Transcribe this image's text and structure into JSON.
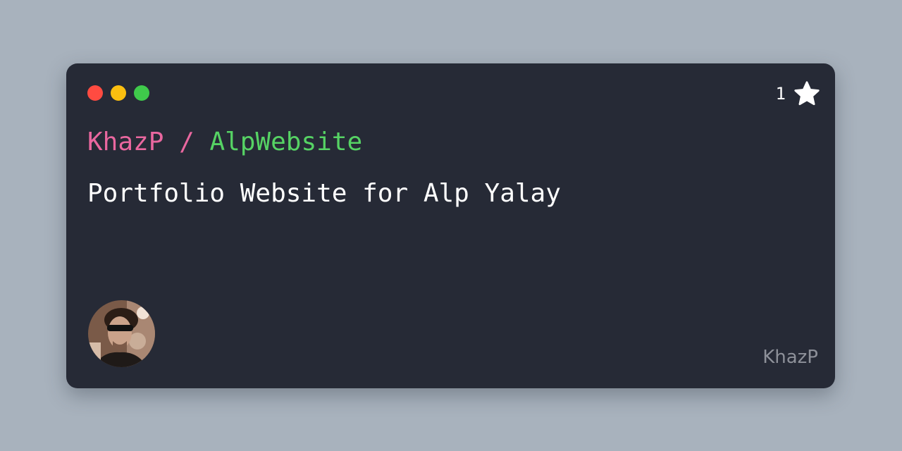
{
  "window_controls": {
    "close_color": "#ff4b41",
    "minimize_color": "#fbbf10",
    "maximize_color": "#3fca4b"
  },
  "stars": {
    "count": "1",
    "icon": "star-icon"
  },
  "repo": {
    "owner": "KhazP",
    "separator": "/",
    "name": "AlpWebsite"
  },
  "description": "Portfolio Website for Alp Yalay",
  "avatar": {
    "icon": "avatar-photo"
  },
  "footer": {
    "username": "KhazP"
  },
  "colors": {
    "background": "#a8b2bd",
    "card": "#262a36",
    "owner": "#e9679f",
    "repo_name": "#56d364",
    "description": "#ffffff",
    "username": "#8d9099"
  }
}
